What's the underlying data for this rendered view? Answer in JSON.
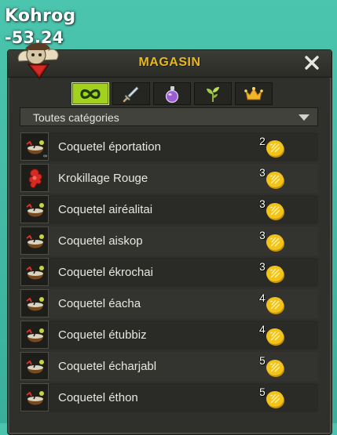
{
  "background": {
    "player_name": "Kohrog",
    "coords_text": "-53,24"
  },
  "window": {
    "title": "MAGASIN",
    "close_glyph": "✕"
  },
  "tabs": [
    {
      "icon": "infinity-icon",
      "active": true
    },
    {
      "icon": "sword-icon",
      "active": false
    },
    {
      "icon": "potion-icon",
      "active": false
    },
    {
      "icon": "sprout-icon",
      "active": false
    },
    {
      "icon": "crown-icon",
      "active": false
    }
  ],
  "filter": {
    "selected": "Toutes catégories"
  },
  "items": [
    {
      "name": "Coquetel éportation",
      "quantity": "2",
      "icon": "cocktail-icon",
      "linked": true
    },
    {
      "name": "Krokillage Rouge",
      "quantity": "3",
      "icon": "red-crest-icon",
      "linked": false
    },
    {
      "name": "Coquetel airéalitai",
      "quantity": "3",
      "icon": "cocktail-icon",
      "linked": false
    },
    {
      "name": "Coquetel aiskop",
      "quantity": "3",
      "icon": "cocktail-icon",
      "linked": false
    },
    {
      "name": "Coquetel ékrochai",
      "quantity": "3",
      "icon": "cocktail-icon",
      "linked": false
    },
    {
      "name": "Coquetel éacha",
      "quantity": "4",
      "icon": "cocktail-icon",
      "linked": false
    },
    {
      "name": "Coquetel étubbiz",
      "quantity": "4",
      "icon": "cocktail-icon",
      "linked": false
    },
    {
      "name": "Coquetel écharjabl",
      "quantity": "5",
      "icon": "cocktail-icon",
      "linked": false
    },
    {
      "name": "Coquetel éthon",
      "quantity": "5",
      "icon": "cocktail-icon",
      "linked": false
    }
  ],
  "colors": {
    "accent_tab": "#a3d21e",
    "title": "#e8b91a",
    "coin": "#f2c318"
  }
}
